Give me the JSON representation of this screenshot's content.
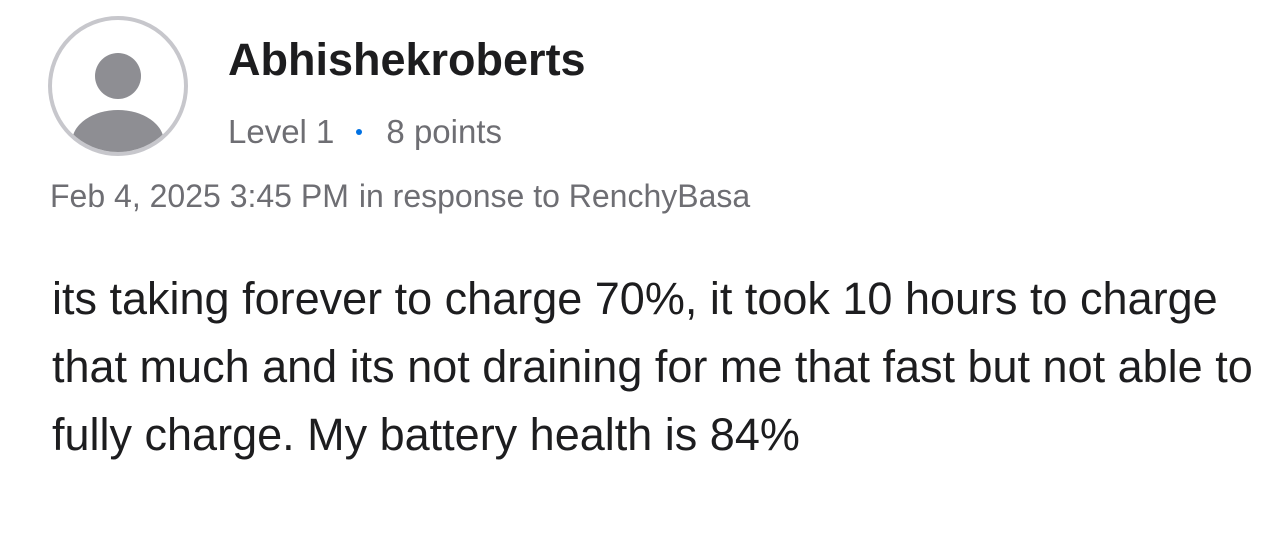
{
  "post": {
    "author": "Abhishekroberts",
    "level": "Level 1",
    "points": "8 points",
    "timestamp": "Feb 4, 2025 3:45 PM",
    "in_response_to": "in response to RenchyBasa",
    "body": "its taking forever to charge 70%, it took 10 hours to charge that much and its not draining for me that fast but not able to fully charge. My battery health is 84%"
  },
  "icons": {
    "avatar": "user-silhouette-icon",
    "separator": "dot-separator-icon"
  },
  "colors": {
    "text_primary": "#1d1d1f",
    "text_secondary": "#6e6e73",
    "avatar_border": "#c7c7cc",
    "avatar_fill": "#8e8e93",
    "separator_dot": "#0071e3",
    "background": "#ffffff"
  }
}
